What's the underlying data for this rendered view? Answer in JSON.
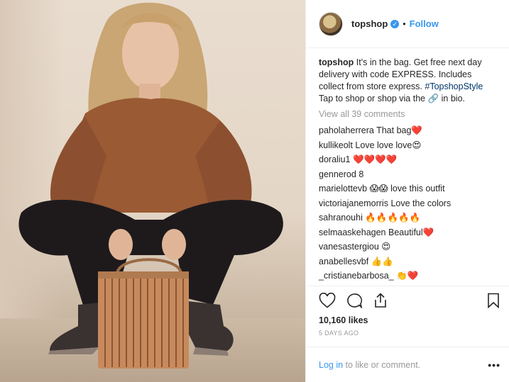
{
  "header": {
    "username": "topshop",
    "verified_icon": "verified-badge-icon",
    "separator": "•",
    "follow_label": "Follow"
  },
  "caption": {
    "username": "topshop",
    "text": "It's in the bag. Get free next day delivery with code EXPRESS. Includes collect from store express.",
    "hashtag": "#TopshopStyle",
    "text_after": "Tap to shop or shop via the",
    "emoji": "🔗",
    "text_end": "in bio."
  },
  "view_all": "View all 39 comments",
  "comments": [
    {
      "user": "paholaherrera",
      "text": "That bag❤️"
    },
    {
      "user": "kullikeolt",
      "text": "Love love love😍"
    },
    {
      "user": "doraliu1",
      "text": "❤️❤️❤️❤️"
    },
    {
      "user": "gennerod",
      "text": "8"
    },
    {
      "user": "marielottevb",
      "text": "😱😱 love this outfit"
    },
    {
      "user": "victoriajanemorris",
      "text": "Love the colors"
    },
    {
      "user": "sahranouhi",
      "text": "🔥🔥🔥🔥🔥"
    },
    {
      "user": "selmaaskehagen",
      "text": "Beautiful❤️"
    },
    {
      "user": "vanesastergiou",
      "text": "😍"
    },
    {
      "user": "anabellesvbf",
      "text": "👍👍"
    },
    {
      "user": "_cristianebarbosa_",
      "text": "👏❤️"
    }
  ],
  "actions": {
    "like_icon": "heart-icon",
    "comment_icon": "comment-icon",
    "share_icon": "share-icon",
    "save_icon": "bookmark-icon"
  },
  "likes": "10,160 likes",
  "time_ago": "5 DAYS AGO",
  "footer": {
    "login_label": "Log in",
    "text": "to like or comment.",
    "more_label": "•••"
  },
  "colors": {
    "link_blue": "#3897f0",
    "hashtag": "#003569",
    "muted": "#999999",
    "divider": "#efefef"
  }
}
